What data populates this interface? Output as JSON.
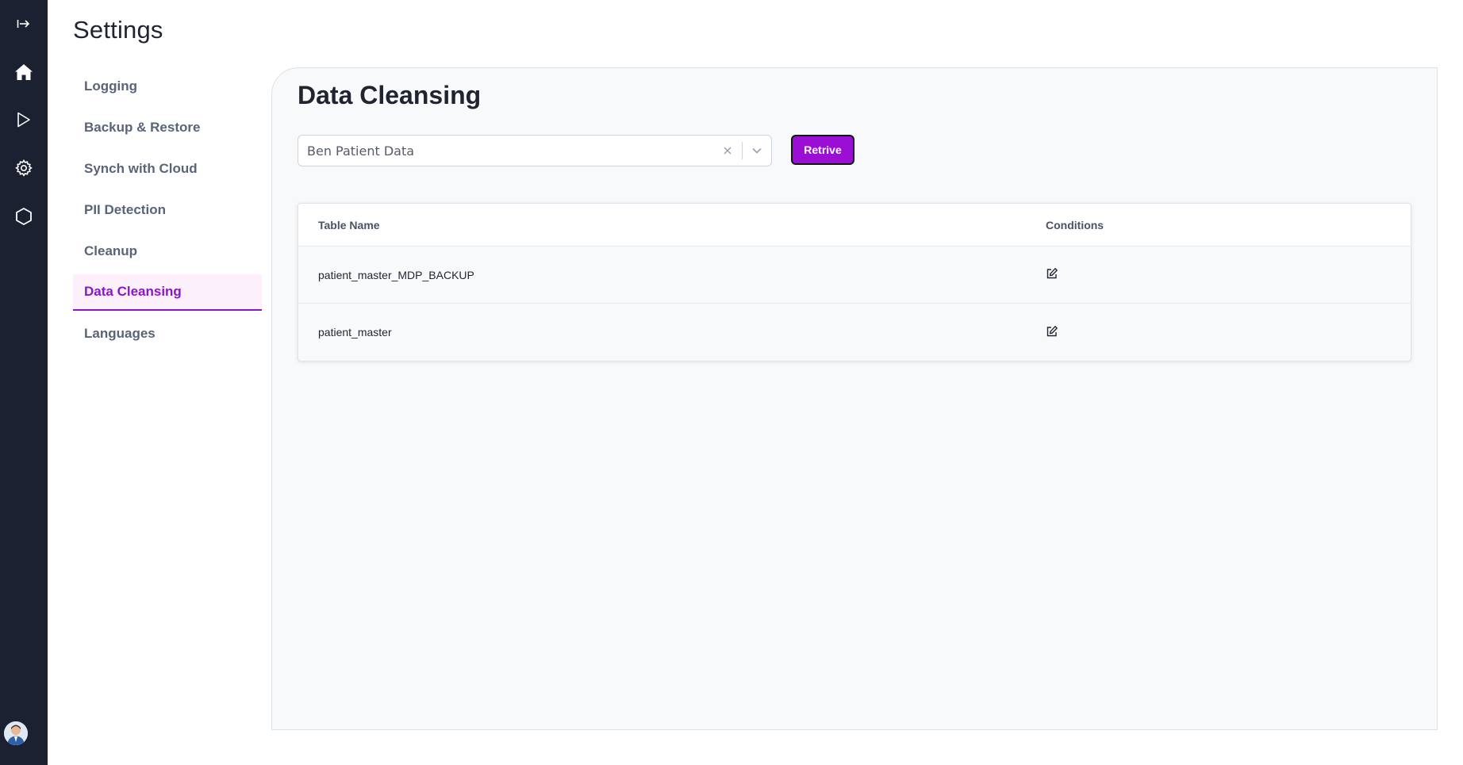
{
  "rail": {
    "items": [
      {
        "name": "expand",
        "icon": "expand-arrow-icon"
      },
      {
        "name": "home",
        "icon": "home-icon"
      },
      {
        "name": "run",
        "icon": "play-icon"
      },
      {
        "name": "settings",
        "icon": "gear-icon"
      },
      {
        "name": "modules",
        "icon": "hexagon-icon"
      }
    ],
    "avatar_icon": "user-avatar"
  },
  "page": {
    "title": "Settings"
  },
  "subnav": {
    "items": [
      {
        "label": "Logging"
      },
      {
        "label": "Backup & Restore"
      },
      {
        "label": "Synch with Cloud"
      },
      {
        "label": "PII Detection"
      },
      {
        "label": "Cleanup"
      },
      {
        "label": "Data Cleansing",
        "active": true
      },
      {
        "label": "Languages"
      }
    ]
  },
  "panel": {
    "title": "Data Cleansing",
    "select": {
      "value": "Ben Patient Data",
      "clear_icon": "close-icon",
      "arrow_icon": "chevron-down-icon"
    },
    "retrieve_label": "Retrive",
    "table": {
      "headers": {
        "name": "Table Name",
        "conditions": "Conditions"
      },
      "rows": [
        {
          "name": "patient_master_MDP_BACKUP",
          "action_icon": "edit-icon"
        },
        {
          "name": "patient_master",
          "action_icon": "edit-icon"
        }
      ]
    }
  },
  "colors": {
    "rail_bg": "#1b2130",
    "accent": "#8a16c7",
    "button_bg": "#9a0fd3",
    "panel_bg": "#f8f9fb"
  }
}
